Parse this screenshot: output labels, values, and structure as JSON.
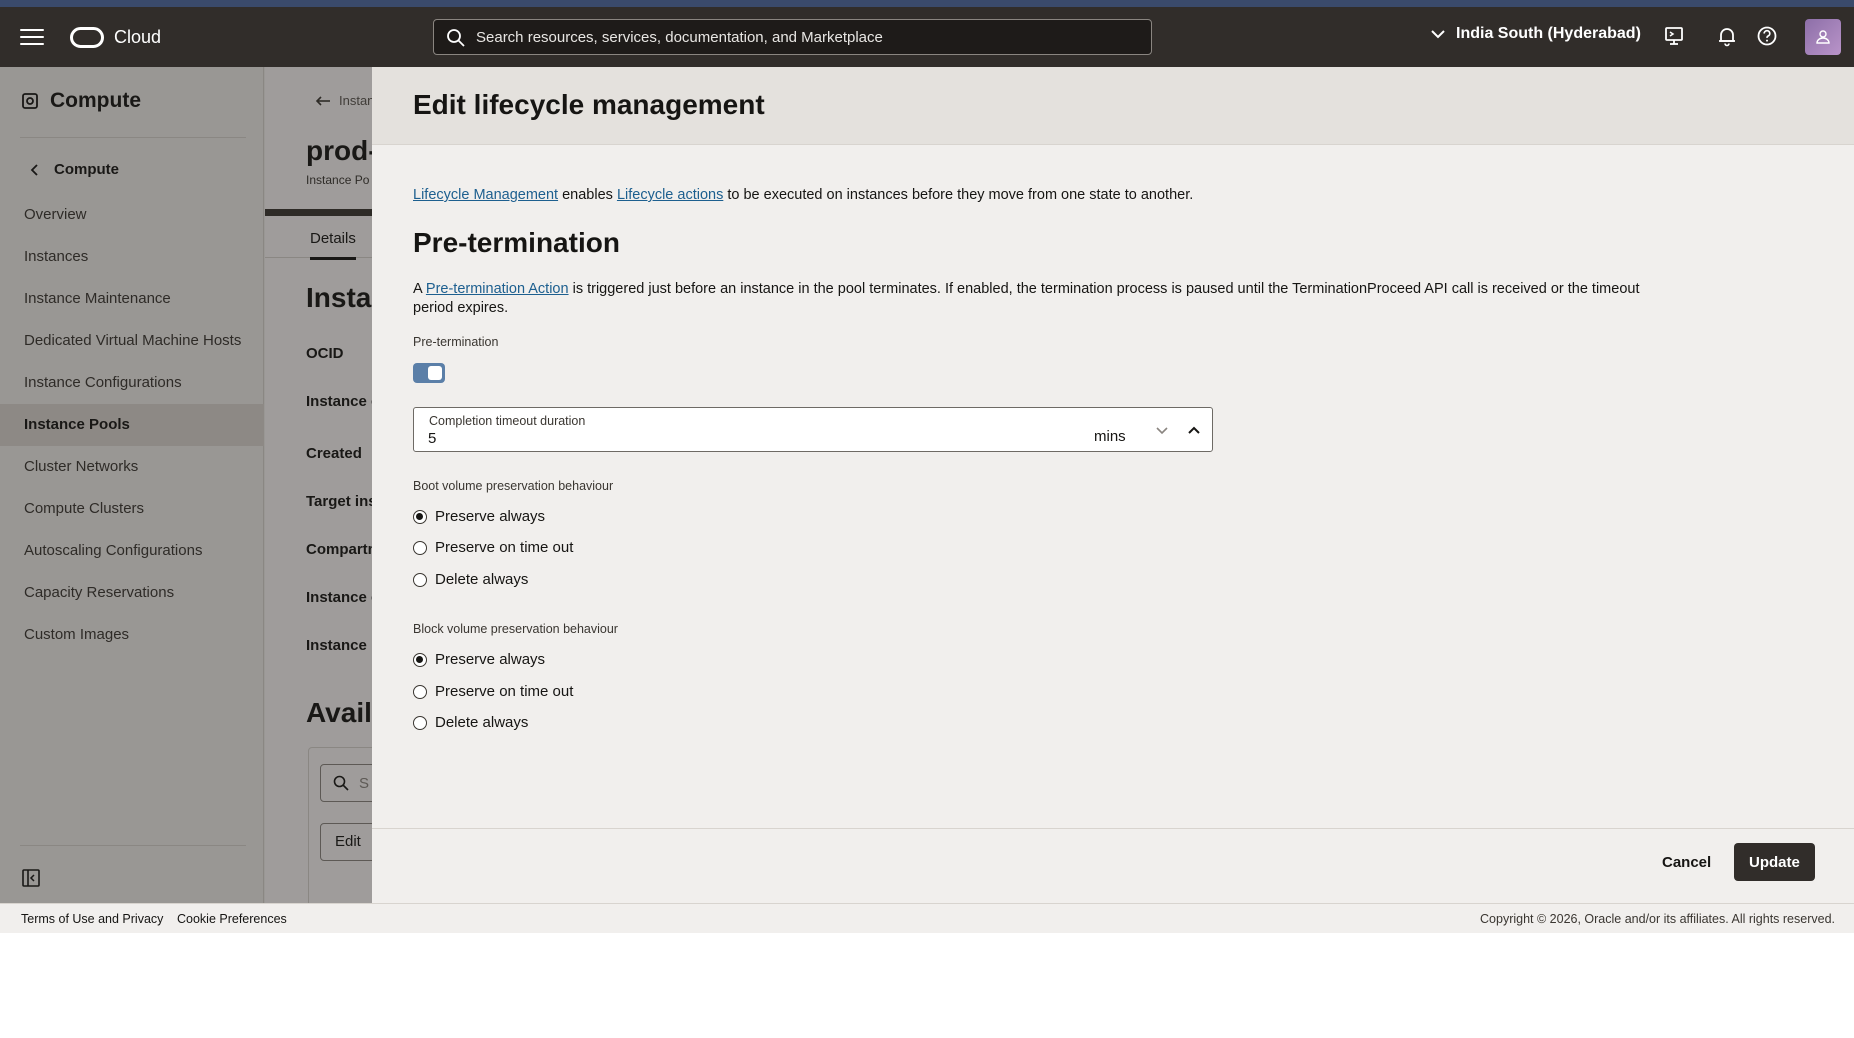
{
  "header": {
    "brand": "Cloud",
    "search_placeholder": "Search resources, services, documentation, and Marketplace",
    "region": "India South (Hyderabad)"
  },
  "sidebar": {
    "title": "Compute",
    "back_label": "Compute",
    "items": [
      {
        "label": "Overview"
      },
      {
        "label": "Instances"
      },
      {
        "label": "Instance Maintenance"
      },
      {
        "label": "Dedicated Virtual Machine Hosts"
      },
      {
        "label": "Instance Configurations"
      },
      {
        "label": "Instance Pools",
        "active": true
      },
      {
        "label": "Cluster Networks"
      },
      {
        "label": "Compute Clusters"
      },
      {
        "label": "Autoscaling Configurations"
      },
      {
        "label": "Capacity Reservations"
      },
      {
        "label": "Custom Images"
      }
    ]
  },
  "background_page": {
    "breadcrumb": "Instan",
    "title": "prod-",
    "subtitle": "Instance Po",
    "tab": "Details",
    "section_title": "Insta",
    "fields": [
      "OCID",
      "Instance c",
      "Created",
      "Target ins",
      "Compartm",
      "Instance c",
      "Instance h"
    ],
    "section2_title": "Avail",
    "search_placeholder": "S",
    "edit_label": "Edit"
  },
  "drawer": {
    "title": "Edit lifecycle management",
    "intro": {
      "link1": "Lifecycle Management",
      "text1": " enables ",
      "link2": "Lifecycle actions",
      "text2": " to be executed on instances before they move from one state to another."
    },
    "section_title": "Pre-termination",
    "description": {
      "prefix": "A ",
      "link": "Pre-termination Action",
      "text": " is triggered just before an instance in the pool terminates. If enabled, the termination process is paused until the TerminationProceed API call is received or the timeout period expires."
    },
    "toggle_label": "Pre-termination",
    "toggle_on": true,
    "timeout": {
      "label": "Completion timeout duration",
      "value": "5",
      "unit": "mins"
    },
    "boot_volume": {
      "label": "Boot volume preservation behaviour",
      "options": [
        "Preserve always",
        "Preserve on time out",
        "Delete always"
      ],
      "selected": "Preserve always"
    },
    "block_volume": {
      "label": "Block volume preservation behaviour",
      "options": [
        "Preserve always",
        "Preserve on time out",
        "Delete always"
      ],
      "selected": "Preserve always"
    },
    "cancel_label": "Cancel",
    "update_label": "Update"
  },
  "footer": {
    "terms": "Terms of Use and Privacy",
    "cookies": "Cookie Preferences",
    "copyright": "Copyright © 2026, Oracle and/or its affiliates. All rights reserved."
  },
  "colors": {
    "header_bg": "#312d2a",
    "link": "#1d5f8f",
    "toggle_on": "#5b7fa8",
    "primary_button": "#312d2a"
  }
}
